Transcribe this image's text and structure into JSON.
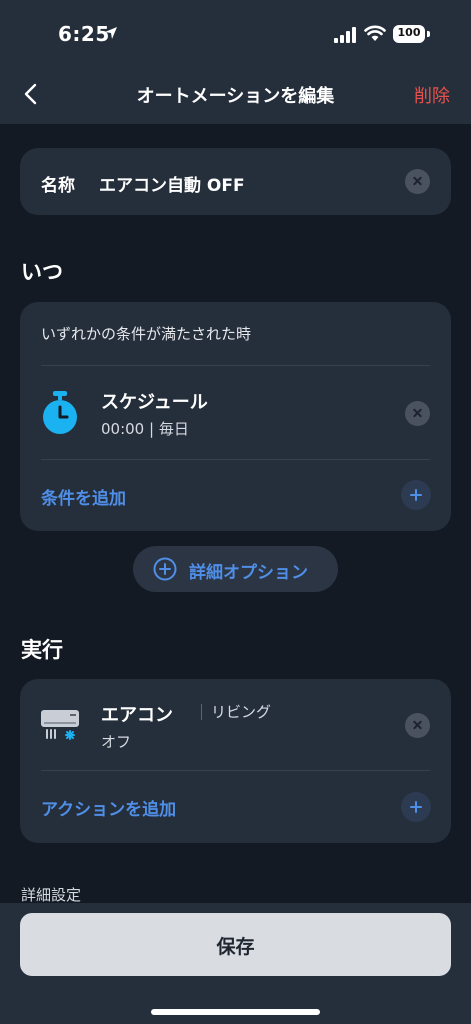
{
  "status_bar": {
    "time": "6:25",
    "battery": "100"
  },
  "nav": {
    "title": "オートメーションを編集",
    "delete_label": "削除"
  },
  "name_card": {
    "label": "名称",
    "value": "エアコン自動 OFF"
  },
  "when_section": {
    "title": "いつ",
    "header": "いずれかの条件が満たされた時",
    "condition": {
      "title": "スケジュール",
      "subtitle": "00:00 | 毎日"
    },
    "add_label": "条件を追加"
  },
  "advanced_options": {
    "label": "詳細オプション"
  },
  "run_section": {
    "title": "実行",
    "action": {
      "device": "エアコン",
      "room": "リビング",
      "state": "オフ"
    },
    "add_label": "アクションを追加"
  },
  "details_settings": {
    "label": "詳細設定"
  },
  "save_button": {
    "label": "保存"
  },
  "colors": {
    "accent": "#4f8fe8",
    "danger": "#e8514b",
    "timer": "#1ab2f0",
    "background": "#131a24",
    "card": "#252e3b"
  },
  "icons": [
    "location-arrow-icon",
    "signal-icon",
    "wifi-icon",
    "battery-icon",
    "back-chevron-icon",
    "clear-icon",
    "timer-icon",
    "plus-icon",
    "plus-circle-icon",
    "air-conditioner-icon"
  ]
}
